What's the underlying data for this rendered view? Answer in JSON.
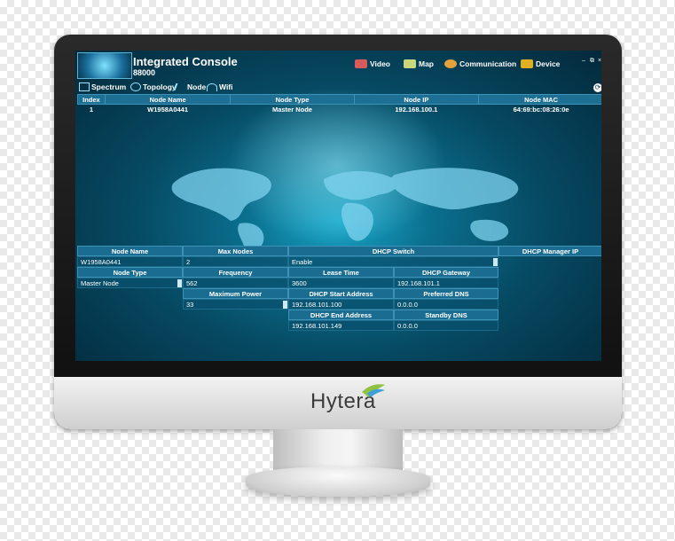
{
  "app": {
    "title": "Integrated Console",
    "subtitle": "88000"
  },
  "topnav": [
    {
      "label": "Video",
      "icon": "video-icon"
    },
    {
      "label": "Map",
      "icon": "map-icon"
    },
    {
      "label": "Communication",
      "icon": "communication-icon"
    },
    {
      "label": "Device",
      "icon": "device-icon"
    }
  ],
  "window_controls": {
    "minimize": "–",
    "restore": "⧉",
    "close": "×"
  },
  "subnav": [
    {
      "label": "Spectrum",
      "icon": "spectrum-icon"
    },
    {
      "label": "Topology",
      "icon": "topology-icon"
    },
    {
      "label": "Node",
      "icon": "node-icon"
    },
    {
      "label": "Wifi",
      "icon": "wifi-icon"
    }
  ],
  "node_table": {
    "headers": [
      "Index",
      "Node Name",
      "Node Type",
      "Node IP",
      "Node MAC"
    ],
    "rows": [
      [
        "1",
        "W1958A0441",
        "Master Node",
        "192.168.100.1",
        "64:69:bc:08:26:0e"
      ]
    ]
  },
  "form": {
    "node_name_label": "Node Name",
    "node_name_value": "W1958A0441",
    "max_nodes_label": "Max Nodes",
    "max_nodes_value": "2",
    "dhcp_switch_label": "DHCP Switch",
    "dhcp_switch_value": "Enable",
    "dhcp_manager_ip_label": "DHCP Manager IP",
    "node_type_label": "Node Type",
    "node_type_value": "Master Node",
    "frequency_label": "Frequency",
    "frequency_value": "562",
    "lease_time_label": "Lease Time",
    "lease_time_value": "3600",
    "dhcp_gateway_label": "DHCP Gateway",
    "dhcp_gateway_value": "192.168.101.1",
    "max_power_label": "Maximum Power",
    "max_power_value": "33",
    "dhcp_start_label": "DHCP Start Address",
    "dhcp_start_value": "192.168.101.100",
    "preferred_dns_label": "Preferred DNS",
    "preferred_dns_value": "0.0.0.0",
    "dhcp_end_label": "DHCP End Address",
    "dhcp_end_value": "192.168.101.149",
    "standby_dns_label": "Standby DNS",
    "standby_dns_value": "0.0.0.0"
  },
  "brand": {
    "logo_text": "Hytera"
  },
  "colors": {
    "screen_bg": "#064a63",
    "header_bg": "#1a6d91",
    "accent": "#18a7c9"
  }
}
